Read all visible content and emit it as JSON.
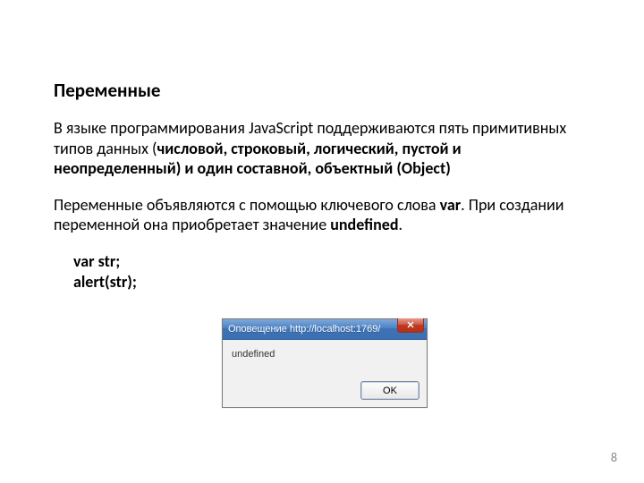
{
  "heading": "Переменные",
  "para1_prefix": "В языке программирования JavaScript поддерживаются пять примитивных типов данных (",
  "para1_bold": "числовой, строковый, логический, пустой и неопределенный) и один составной, объектный (Object)",
  "para2_part1": "Переменные объявляются с помощью ключевого слова ",
  "para2_var": "var",
  "para2_part2": ". При создании переменной она приобретает значение ",
  "para2_undef": "undefined",
  "para2_part3": ".",
  "code_line1": "var  str;",
  "code_line2": "alert(str);",
  "dialog": {
    "title": "Оповещение http://localhost:1769/",
    "message": "undefined",
    "ok": "OK"
  },
  "page_number": "8"
}
